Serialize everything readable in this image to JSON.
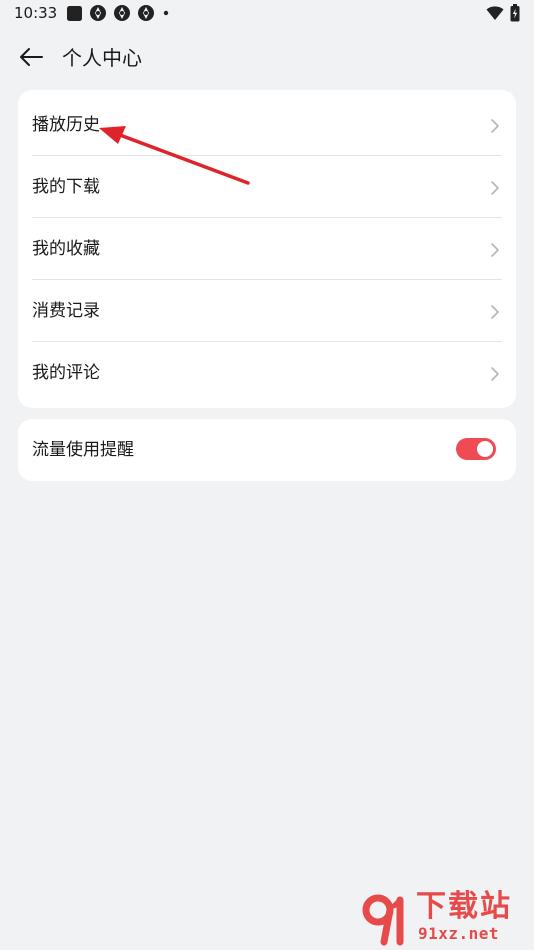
{
  "status_bar": {
    "time": "10:33",
    "icons": [
      "square-icon",
      "app-icon",
      "app-icon",
      "app-icon",
      "dot-icon"
    ],
    "right_icons": [
      "wifi-icon",
      "battery-charging-icon"
    ]
  },
  "header": {
    "back_icon": "arrow-left-icon",
    "title": "个人中心"
  },
  "menu": {
    "items": [
      {
        "label": "播放历史",
        "icon": "chevron-right-icon"
      },
      {
        "label": "我的下载",
        "icon": "chevron-right-icon"
      },
      {
        "label": "我的收藏",
        "icon": "chevron-right-icon"
      },
      {
        "label": "消费记录",
        "icon": "chevron-right-icon"
      },
      {
        "label": "我的评论",
        "icon": "chevron-right-icon"
      }
    ]
  },
  "settings": {
    "data_usage_reminder": {
      "label": "流量使用提醒",
      "enabled": true
    }
  },
  "colors": {
    "background": "#f1f2f4",
    "card": "#ffffff",
    "toggle_on": "#ef4b55",
    "annotation_arrow": "#e0232a",
    "watermark": "#e64a4a"
  },
  "watermark": {
    "title": "下载站",
    "url": "91xz.net"
  }
}
